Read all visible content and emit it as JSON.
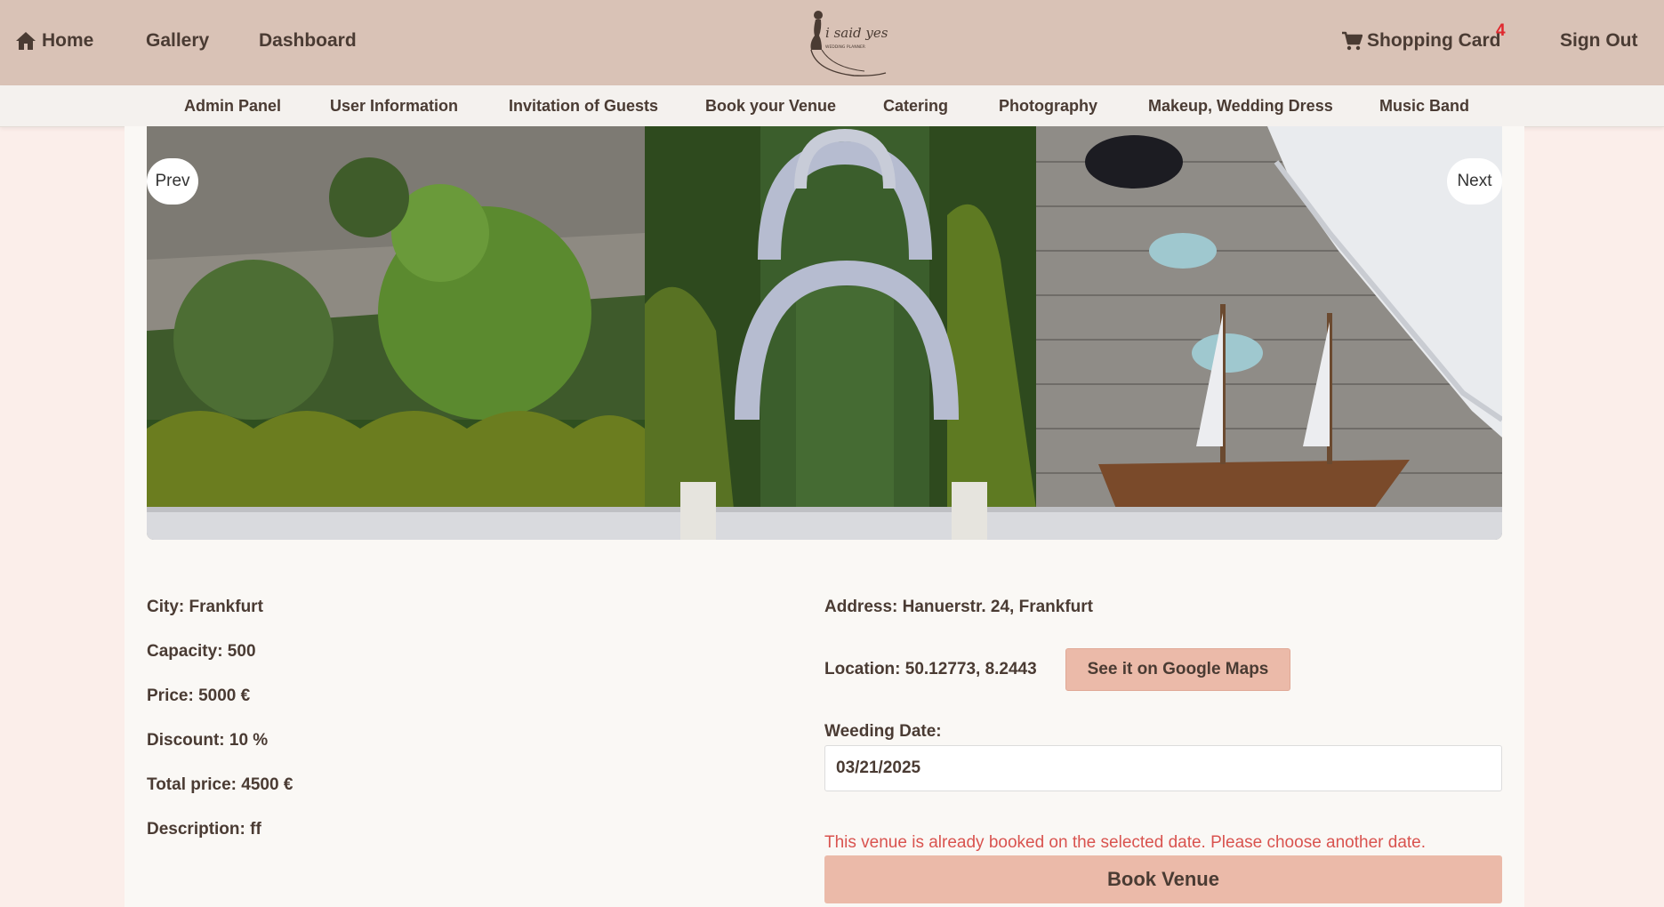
{
  "header": {
    "home_label": "Home",
    "gallery_label": "Gallery",
    "dashboard_label": "Dashboard",
    "cart_label": "Shopping Card",
    "cart_count": "4",
    "signout_label": "Sign Out",
    "logo_text": "i said yes",
    "logo_subtext": "WEDDING PLANNER"
  },
  "subnav": {
    "items": [
      {
        "label": "Admin Panel"
      },
      {
        "label": "User Information"
      },
      {
        "label": "Invitation of Guests"
      },
      {
        "label": "Book your Venue"
      },
      {
        "label": "Catering"
      },
      {
        "label": "Photography"
      },
      {
        "label": "Makeup, Wedding Dress"
      },
      {
        "label": "Music Band"
      }
    ]
  },
  "carousel": {
    "prev_label": "Prev",
    "next_label": "Next"
  },
  "venue": {
    "city": "City: Frankfurt",
    "capacity": "Capacity: 500",
    "price": "Price: 5000 €",
    "discount": "Discount: 10 %",
    "total_price": "Total price: 4500 €",
    "description": "Description: ff",
    "address": "Address: Hanuerstr. 24, Frankfurt",
    "location": "Location: 50.12773, 8.2443",
    "maps_label": "See it on Google Maps",
    "date_label": "Weeding Date:",
    "date_value": "03/21/2025",
    "error_message": "This venue is already booked on the selected date. Please choose another date.",
    "book_label": "Book Venue"
  },
  "colors": {
    "header_bg": "#d9c2b6",
    "page_bg": "#fbeeea",
    "accent_button": "#ebbaa9",
    "error": "#d9534f",
    "badge": "#e0282e"
  }
}
